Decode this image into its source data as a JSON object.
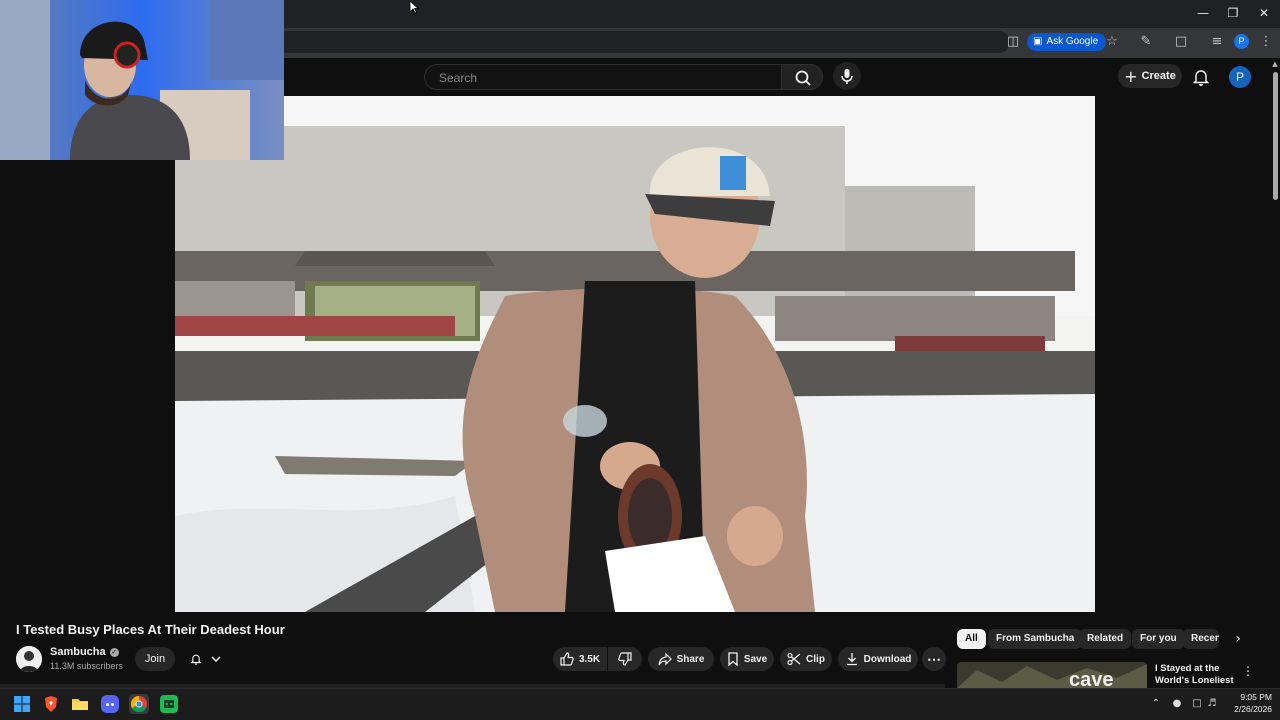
{
  "browser": {
    "ask_google_label": "Ask Google",
    "profile_initial": "P"
  },
  "masthead": {
    "search_placeholder": "Search",
    "create_label": "Create",
    "avatar_initial": "P"
  },
  "video": {
    "title": "I Tested Busy Places At Their Deadest Hour",
    "channel_name": "Sambucha",
    "subscribers": "11.3M subscribers",
    "join_label": "Join",
    "like_count": "3.5K",
    "share_label": "Share",
    "save_label": "Save",
    "clip_label": "Clip",
    "download_label": "Download",
    "more_label": "⋯"
  },
  "chips": [
    "All",
    "From Sambucha",
    "Related",
    "For you",
    "Recen"
  ],
  "recommendation": {
    "title": "I Stayed at the World's Loneliest ...",
    "thumb_text": "cave"
  },
  "taskbar": {
    "time": "9:05 PM",
    "date": "2/26/2026"
  },
  "colors": {
    "youtube_bg": "#0f0f0f",
    "chip_active": "#f1f1f1",
    "ask_google": "#0b57d0",
    "avatar": "#1565c0"
  }
}
